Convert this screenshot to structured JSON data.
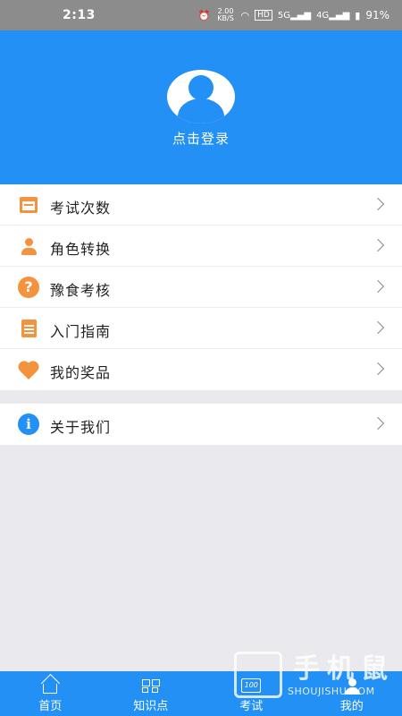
{
  "status_bar": {
    "time": "2:13",
    "speed": "2.00 KB/S",
    "network1": "5G",
    "network2": "4G",
    "battery": "91%"
  },
  "header": {
    "login_text": "点击登录",
    "bg_color": "#2290f4"
  },
  "menu_group_1": [
    {
      "label": "考试次数",
      "icon": "calendar-icon"
    },
    {
      "label": "角色转换",
      "icon": "person-icon"
    },
    {
      "label": "豫食考核",
      "icon": "question-icon"
    },
    {
      "label": "入门指南",
      "icon": "document-icon"
    },
    {
      "label": "我的奖品",
      "icon": "heart-icon"
    }
  ],
  "menu_group_2": [
    {
      "label": "关于我们",
      "icon": "info-icon"
    }
  ],
  "tabbar": [
    {
      "label": "首页",
      "icon": "home-icon"
    },
    {
      "label": "知识点",
      "icon": "grid-icon"
    },
    {
      "label": "考试",
      "icon": "exam-icon"
    },
    {
      "label": "我的",
      "icon": "person-icon",
      "active": true
    }
  ],
  "watermark": {
    "cn": "手机鼠",
    "en": "SHOUJISHU.COM"
  },
  "colors": {
    "accent": "#2290f4",
    "icon_orange": "#f5923e",
    "background": "#e9e9ee"
  }
}
